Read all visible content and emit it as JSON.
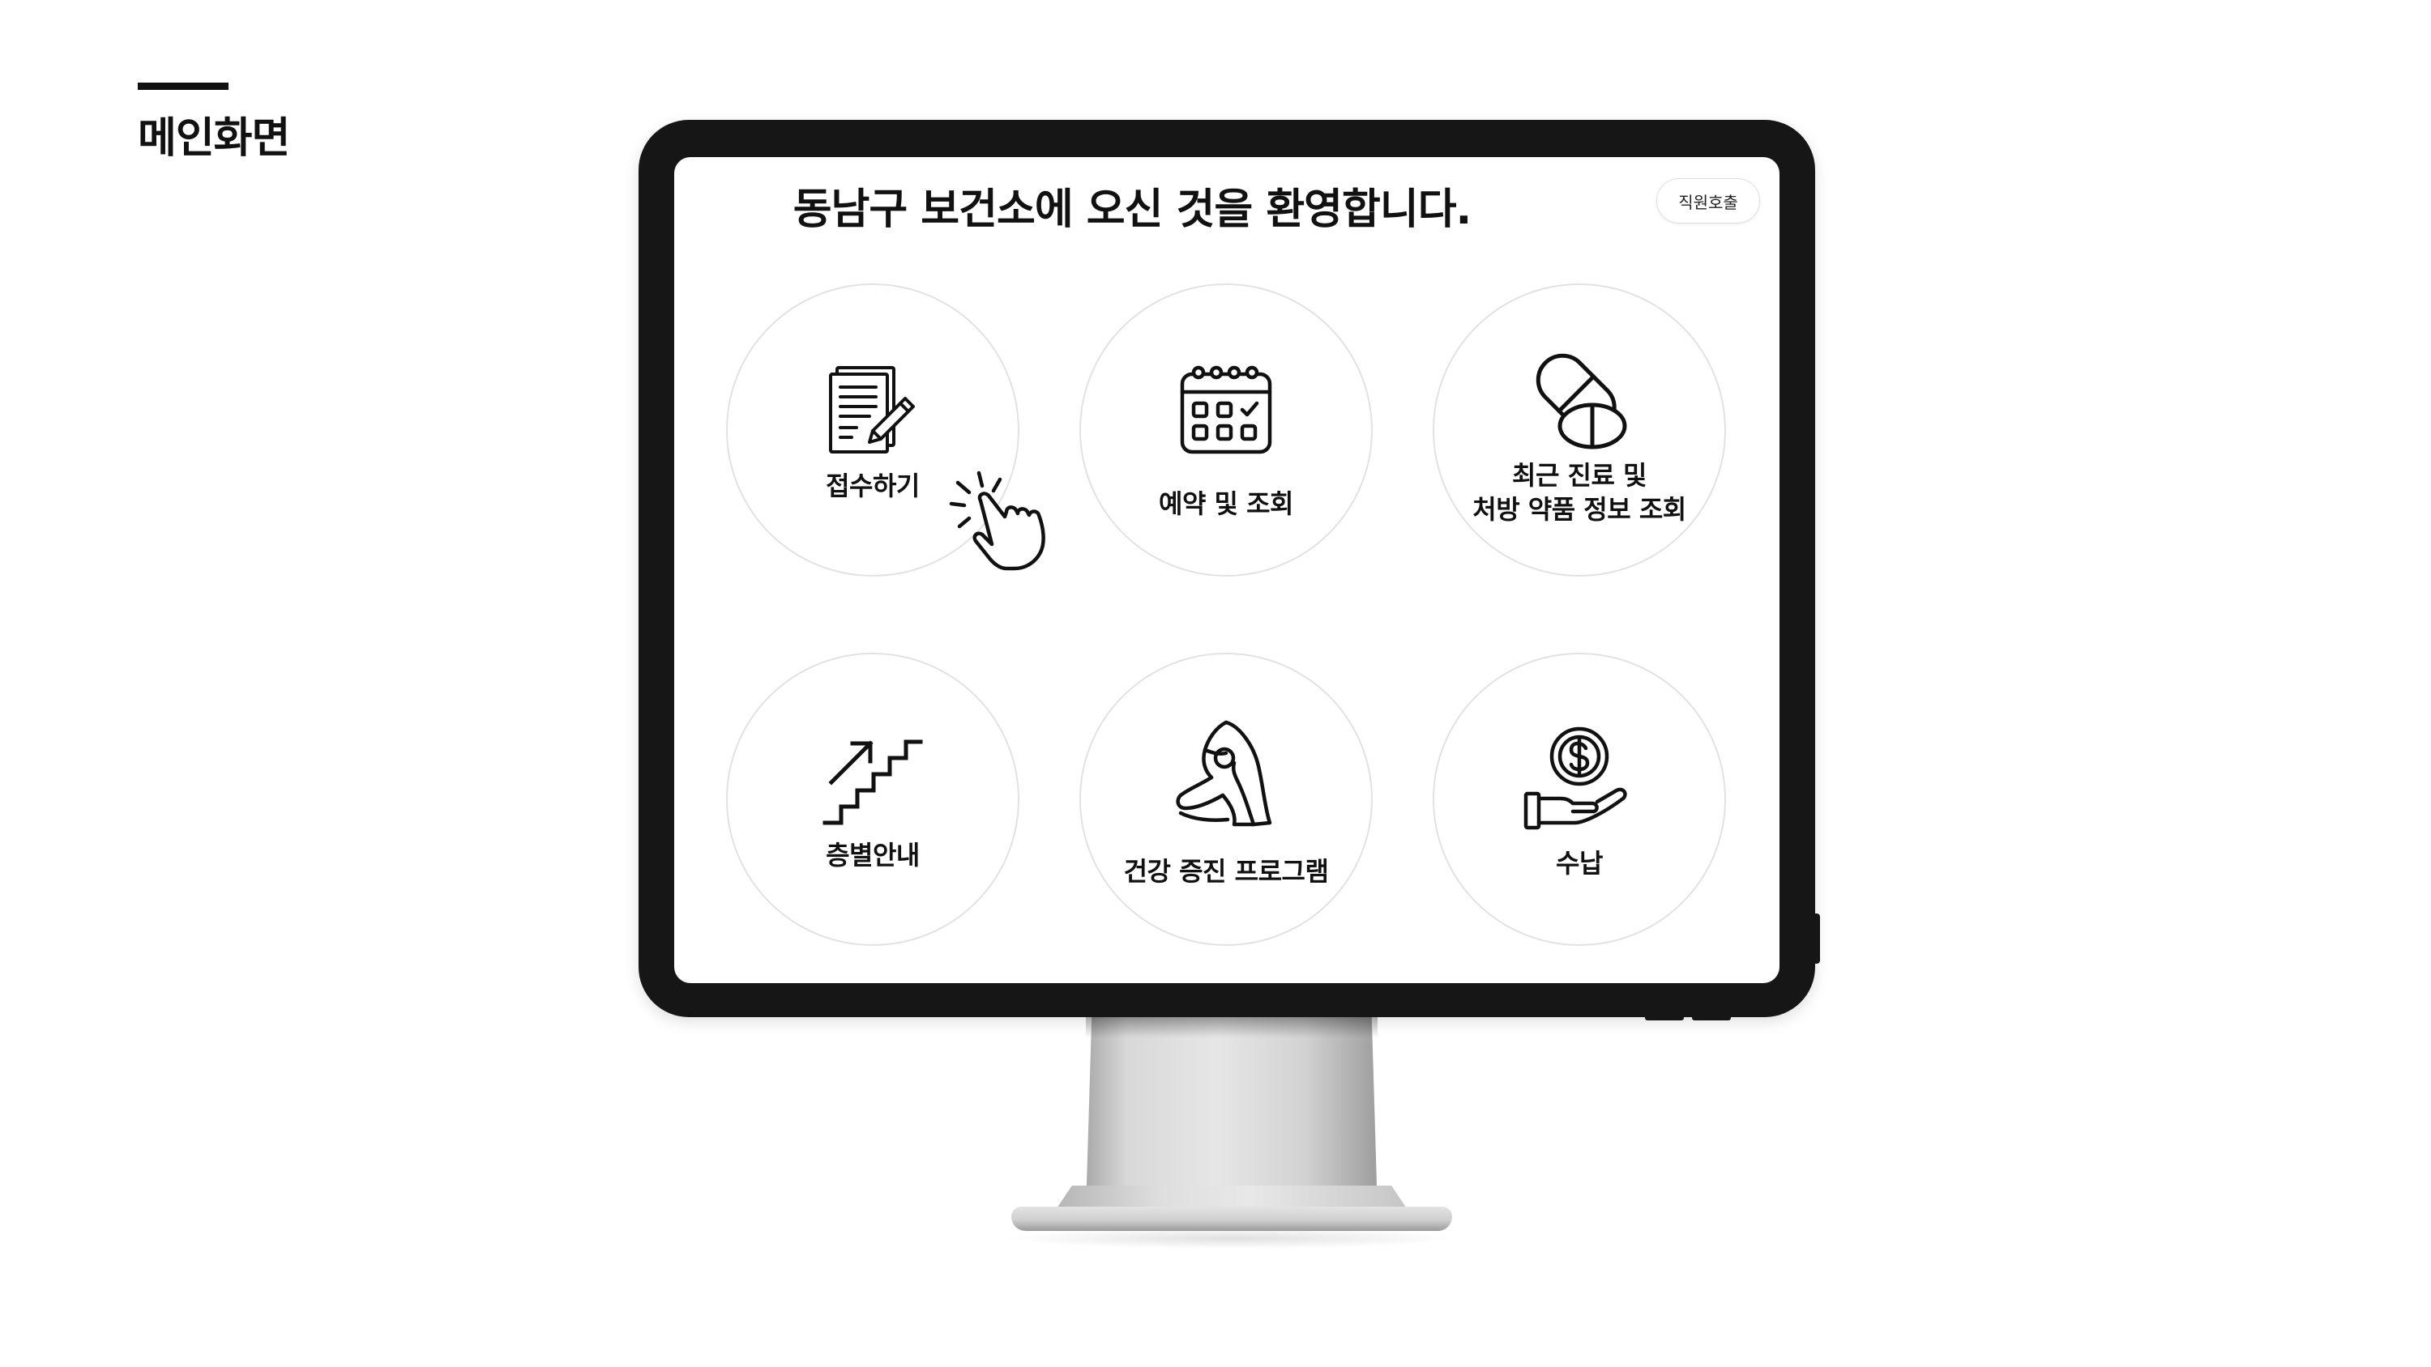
{
  "slide": {
    "title": "메인화면"
  },
  "kiosk": {
    "welcome_title": "동남구 보건소에 오신 것을 환영합니다.",
    "staff_call_label": "직원호출",
    "menu": [
      {
        "id": "reception",
        "label_lines": [
          "접수하기"
        ],
        "icon": "document-pen-icon"
      },
      {
        "id": "reservation",
        "label_lines": [
          "예약 및 조회"
        ],
        "icon": "calendar-icon"
      },
      {
        "id": "prescription",
        "label_lines": [
          "최근 진료 및",
          "처방 약품 정보 조회"
        ],
        "icon": "pill-capsule-icon"
      },
      {
        "id": "floor-guide",
        "label_lines": [
          "층별안내"
        ],
        "icon": "stairs-arrow-icon"
      },
      {
        "id": "health-program",
        "label_lines": [
          "건강 증진 프로그램"
        ],
        "icon": "yoga-pose-icon"
      },
      {
        "id": "payment",
        "label_lines": [
          "수납"
        ],
        "icon": "hand-coin-icon"
      }
    ]
  },
  "colors": {
    "bezel": "#161616",
    "text": "#111111",
    "circle_border": "#e2e2e2",
    "background": "#ffffff"
  }
}
